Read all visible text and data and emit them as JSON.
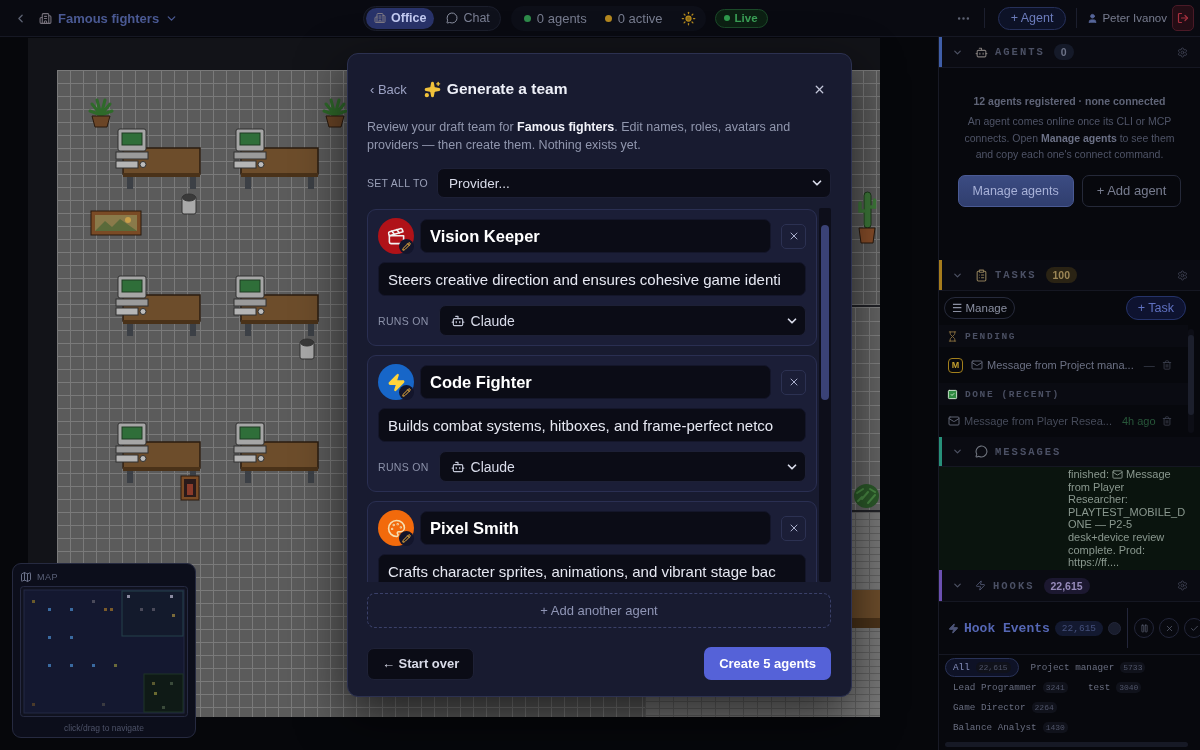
{
  "top_bar": {
    "workspace": "Famous fighters",
    "view_tabs": [
      {
        "kind": "office",
        "label": "Office",
        "selected": true
      },
      {
        "kind": "chat",
        "label": "Chat",
        "selected": false
      }
    ],
    "stats": [
      {
        "text": "0 agents",
        "color": "#2e8b4a"
      },
      {
        "text": "0 active",
        "color": "#b3871f"
      }
    ],
    "live": "Live",
    "add_agent": "+ Agent",
    "user": "Peter Ivanov"
  },
  "minimap": {
    "title": "MAP",
    "hint": "click/drag to navigate"
  },
  "modal": {
    "back": "‹ Back",
    "title": "Generate a team",
    "description": "Review your draft team for **Famous fighters**. Edit names, roles, avatars and providers — then create them. Nothing exists yet.",
    "set_all": {
      "label": "SET ALL TO",
      "placeholder": "Provider..."
    },
    "agents": [
      {
        "kind": "film",
        "color": "#b01218",
        "name": "Vision Keeper",
        "role": "Steers creative direction and ensures cohesive game identi",
        "runs_on": {
          "label": "RUNS ON",
          "provider": "Claude"
        }
      },
      {
        "kind": "bolt",
        "color": "#1766c8",
        "name": "Code Fighter",
        "role": "Builds combat systems, hitboxes, and frame-perfect netco",
        "runs_on": {
          "label": "RUNS ON",
          "provider": "Claude"
        }
      },
      {
        "kind": "palette",
        "color": "#f26a0c",
        "name": "Pixel Smith",
        "role": "Crafts character sprites, animations, and vibrant stage bac"
      }
    ],
    "add_another": "+ Add another agent",
    "start_over": "← Start over",
    "create": "Create 5 agents"
  },
  "panels": [
    {
      "kind": "agents",
      "title": "AGENTS",
      "count": "0",
      "expanded": true,
      "color": "#3f5ea8",
      "summary": "12 agents registered · none connected",
      "help": "An agent comes online once its CLI or MCP connects. Open **Manage agents** to see them and copy each one's connect command.",
      "actions": [
        {
          "kind": "primary",
          "label": "Manage agents"
        },
        {
          "kind": "secondary",
          "label": "+ Add agent"
        }
      ]
    },
    {
      "kind": "tasks",
      "title": "TASKS",
      "count": "100",
      "expanded": true,
      "color": "#a67c1c",
      "actions": [
        {
          "kind": "secondary",
          "label": "☰ Manage"
        },
        {
          "kind": "primary",
          "label": "+ Task"
        }
      ],
      "groups": [
        {
          "kind": "pending",
          "title": "PENDING",
          "items": [
            {
              "badge": "M",
              "text": "Message from Project mana...",
              "meta": "—"
            }
          ]
        },
        {
          "kind": "done",
          "title": "DONE (RECENT)",
          "items": [
            {
              "text": "Message from Player Resea...",
              "meta": "4h ago"
            }
          ]
        }
      ]
    },
    {
      "kind": "messages",
      "title": "MESSAGES",
      "expanded": true,
      "color": "#27907a",
      "entries": [
        {
          "lead": "finished:",
          "subject": "Message",
          "body": "from Player Researcher: PLAYTEST_MOBILE_DONE — P2-5 desk+device review complete. Prod: https://ff...."
        }
      ]
    },
    {
      "kind": "hooks",
      "title": "HOOKS",
      "count": "22,615",
      "expanded": true,
      "color": "#6b50b0",
      "events": {
        "title": "Hook Events",
        "count": "22,615",
        "filters": [
          {
            "label": "All",
            "count": "22,615",
            "selected": true
          },
          {
            "label": "Project manager",
            "count": "5733",
            "selected": false
          },
          {
            "label": "Lead Programmer",
            "count": "3241",
            "selected": false
          },
          {
            "label": "test",
            "count": "3040",
            "selected": false
          },
          {
            "label": "Game Director",
            "count": "2264",
            "selected": false
          },
          {
            "label": "Balance Analyst",
            "count": "1430",
            "selected": false
          }
        ]
      }
    }
  ]
}
